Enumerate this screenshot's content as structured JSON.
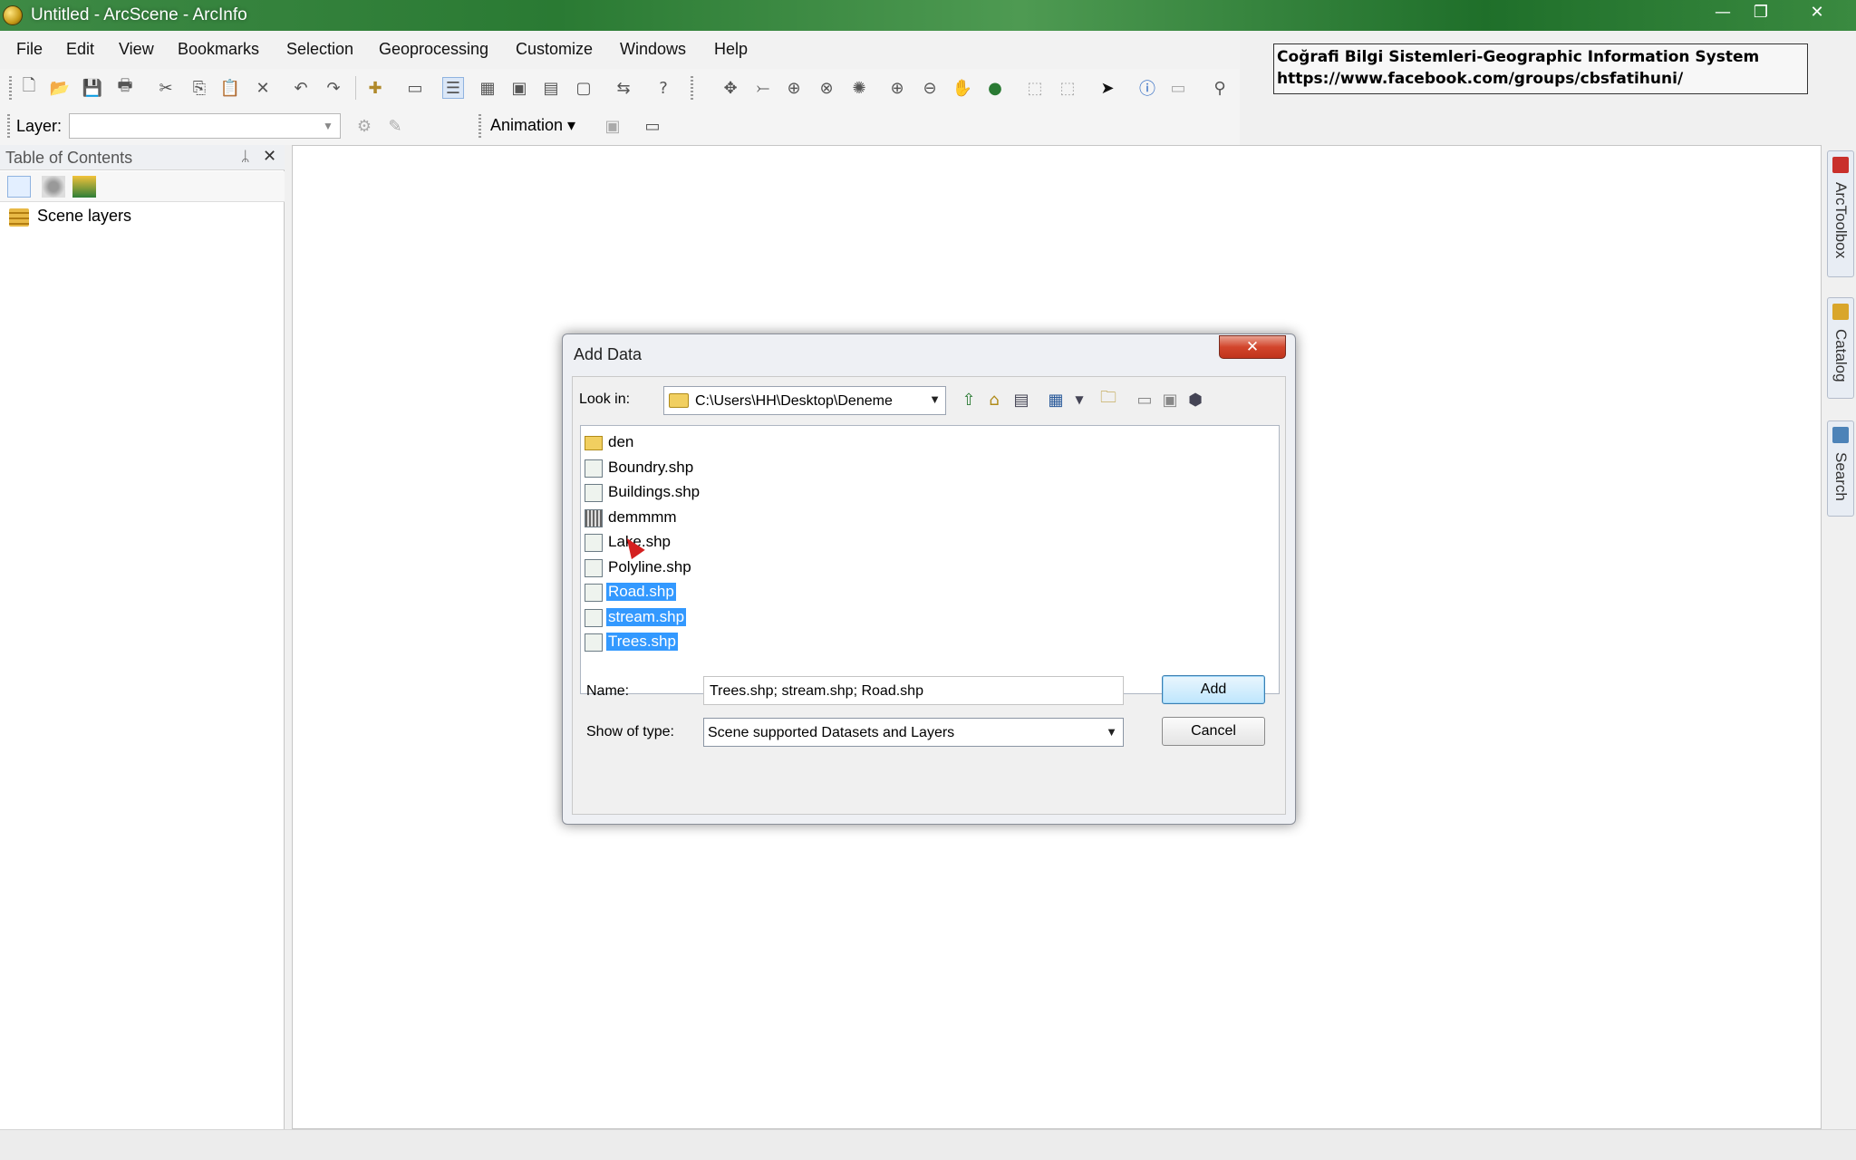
{
  "window": {
    "title": "Untitled - ArcScene - ArcInfo",
    "controls": [
      "—",
      "❐",
      "✕"
    ]
  },
  "menu": [
    "File",
    "Edit",
    "View",
    "Bookmarks",
    "Selection",
    "Geoprocessing",
    "Customize",
    "Windows",
    "Help"
  ],
  "toolbar2": {
    "layer_label": "Layer:",
    "layer_value": "",
    "animation_label": "Animation ▾"
  },
  "note": {
    "line1": "Coğrafi Bilgi Sistemleri-Geographic Information System",
    "line2": "https://www.facebook.com/groups/cbsfatihuni/"
  },
  "toc": {
    "title": "Table of Contents",
    "pin": "ᛦ",
    "close": "✕",
    "layers": [
      "Scene layers"
    ]
  },
  "dock": [
    "ArcToolbox",
    "Catalog",
    "Search"
  ],
  "dialog": {
    "title": "Add Data",
    "close": "✕",
    "look_in_label": "Look in:",
    "look_in_value": "C:\\Users\\HH\\Desktop\\Deneme",
    "files": [
      {
        "name": "den",
        "kind": "folder",
        "selected": false
      },
      {
        "name": "Boundry.shp",
        "kind": "polygon",
        "selected": false
      },
      {
        "name": "Buildings.shp",
        "kind": "point",
        "selected": false
      },
      {
        "name": "demmmm",
        "kind": "raster",
        "selected": false
      },
      {
        "name": "Lake.shp",
        "kind": "polygon",
        "selected": false
      },
      {
        "name": "Polyline.shp",
        "kind": "line",
        "selected": false
      },
      {
        "name": "Road.shp",
        "kind": "line",
        "selected": true
      },
      {
        "name": "stream.shp",
        "kind": "line",
        "selected": true
      },
      {
        "name": "Trees.shp",
        "kind": "point",
        "selected": true
      }
    ],
    "name_label": "Name:",
    "name_value": "Trees.shp; stream.shp; Road.shp",
    "type_label": "Show of type:",
    "type_value": "Scene supported Datasets and Layers",
    "add_label": "Add",
    "cancel_label": "Cancel"
  },
  "colors": {
    "titlebar": "#2a7a33",
    "selection": "#3399ff",
    "close_button": "#d2452c"
  }
}
